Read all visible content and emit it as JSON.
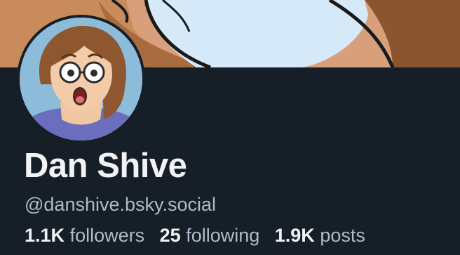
{
  "profile": {
    "display_name": "Dan Shive",
    "handle": "@danshive.bsky.social",
    "stats": {
      "followers_count": "1.1K",
      "followers_label": "followers",
      "following_count": "25",
      "following_label": "following",
      "posts_count": "1.9K",
      "posts_label": "posts"
    }
  },
  "colors": {
    "background": "#161e27",
    "text_primary": "#f1f3f5",
    "text_secondary": "#aebbc9"
  }
}
